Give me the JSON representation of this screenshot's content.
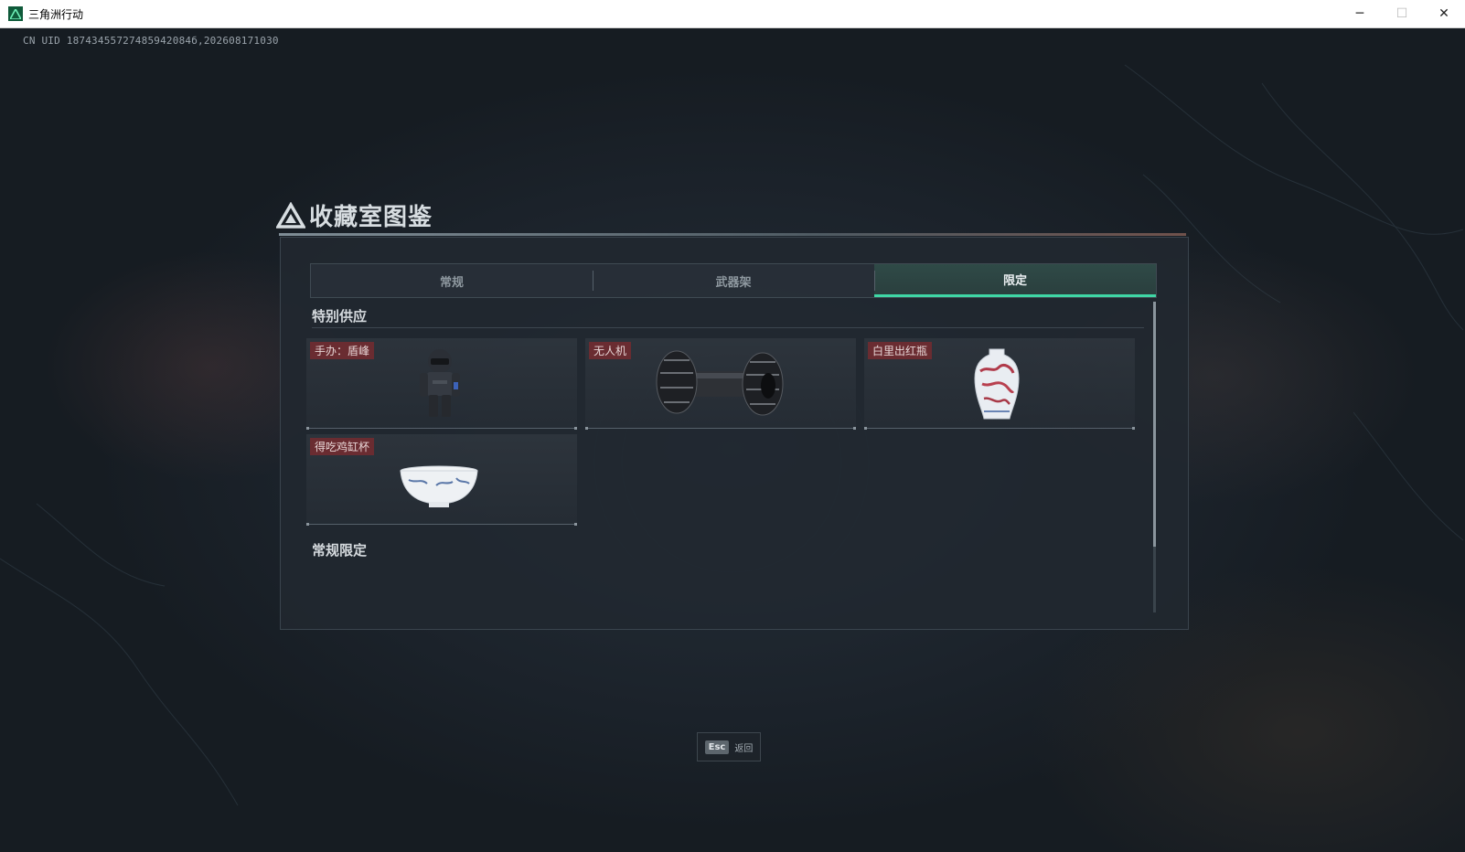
{
  "window": {
    "title": "三角洲行动",
    "controls": {
      "minimize": "─",
      "maximize": "☐",
      "close": "✕"
    }
  },
  "uid_text": "CN UID 18743455727485942084б,202608171030",
  "heading": {
    "title": "收藏室图鉴",
    "icon": "delta-logo-icon"
  },
  "tabs": [
    {
      "label": "常规",
      "active": false
    },
    {
      "label": "武器架",
      "active": false
    },
    {
      "label": "限定",
      "active": true
    }
  ],
  "sections": {
    "special": {
      "title": "特别供应",
      "items": [
        {
          "label": "手办：盾峰",
          "icon": "figure-icon"
        },
        {
          "label": "无人机",
          "icon": "drone-icon"
        },
        {
          "label": "白里出红瓶",
          "icon": "vase-icon"
        },
        {
          "label": "得吃鸡缸杯",
          "icon": "bowl-icon"
        }
      ]
    },
    "regular_limited": {
      "title": "常规限定"
    }
  },
  "esc_hint": {
    "key": "Esc",
    "label": "返回"
  },
  "colors": {
    "accent": "#3fd6a5",
    "label_bg": "#6a2c31",
    "panel_bg": "#212830"
  }
}
